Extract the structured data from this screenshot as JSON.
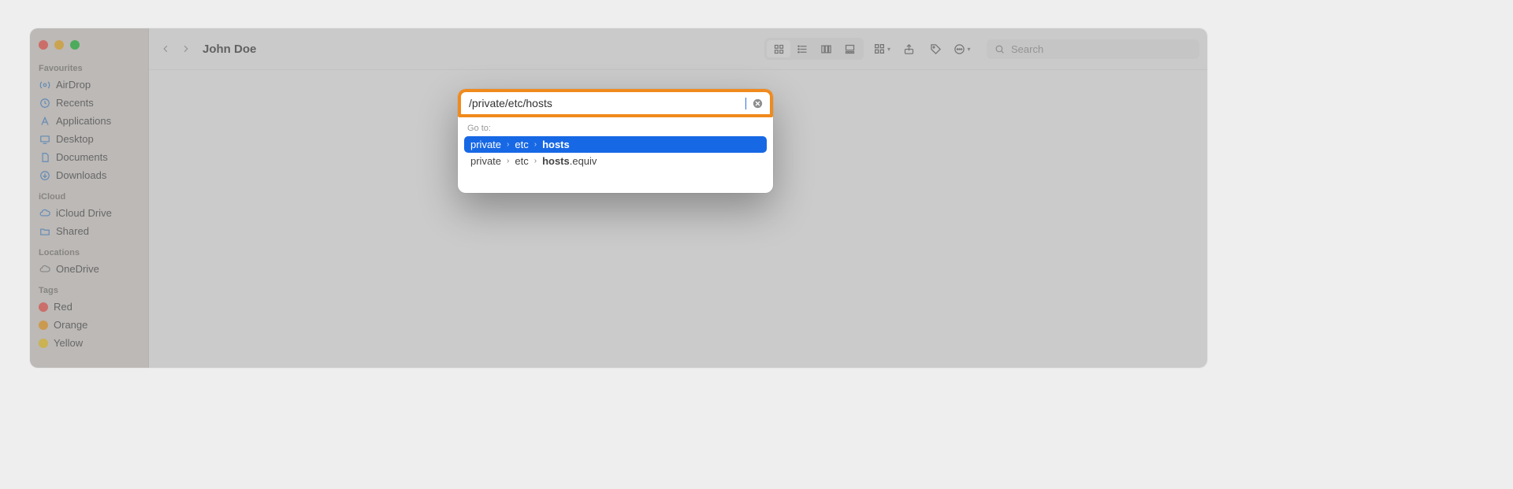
{
  "window": {
    "title": "John Doe"
  },
  "traffic_lights": {
    "close": "#ff5f57",
    "minimize": "#febc2e",
    "zoom": "#28c840"
  },
  "sidebar": {
    "sections": [
      {
        "label": "Favourites",
        "items": [
          {
            "name": "AirDrop",
            "icon": "airdrop-icon"
          },
          {
            "name": "Recents",
            "icon": "clock-icon"
          },
          {
            "name": "Applications",
            "icon": "a-icon"
          },
          {
            "name": "Desktop",
            "icon": "desktop-icon"
          },
          {
            "name": "Documents",
            "icon": "document-icon"
          },
          {
            "name": "Downloads",
            "icon": "download-icon"
          }
        ]
      },
      {
        "label": "iCloud",
        "items": [
          {
            "name": "iCloud Drive",
            "icon": "cloud-icon"
          },
          {
            "name": "Shared",
            "icon": "folder-icon"
          }
        ]
      },
      {
        "label": "Locations",
        "items": [
          {
            "name": "OneDrive",
            "icon": "cloud-icon"
          }
        ]
      },
      {
        "label": "Tags",
        "items": [
          {
            "name": "Red",
            "icon": "tag-dot",
            "color": "#ff6159"
          },
          {
            "name": "Orange",
            "icon": "tag-dot",
            "color": "#ffab2e"
          },
          {
            "name": "Yellow",
            "icon": "tag-dot",
            "color": "#ffd52f"
          }
        ]
      }
    ]
  },
  "toolbar": {
    "back_icon": "chevron-left-icon",
    "forward_icon": "chevron-right-icon",
    "view_icons": [
      "grid-icon",
      "list-icon",
      "column-icon",
      "gallery-icon"
    ],
    "action_icons": [
      "group-icon",
      "share-icon",
      "tag-icon",
      "action-menu-icon"
    ],
    "search_placeholder": "Search"
  },
  "goto": {
    "input_value": "/private/etc/hosts",
    "label": "Go to:",
    "highlight_color": "#f08a1d",
    "suggestions": [
      {
        "segments": [
          "private",
          "etc"
        ],
        "match": "hosts",
        "suffix": "",
        "selected": true
      },
      {
        "segments": [
          "private",
          "etc"
        ],
        "match": "hosts",
        "suffix": ".equiv",
        "selected": false
      }
    ]
  }
}
